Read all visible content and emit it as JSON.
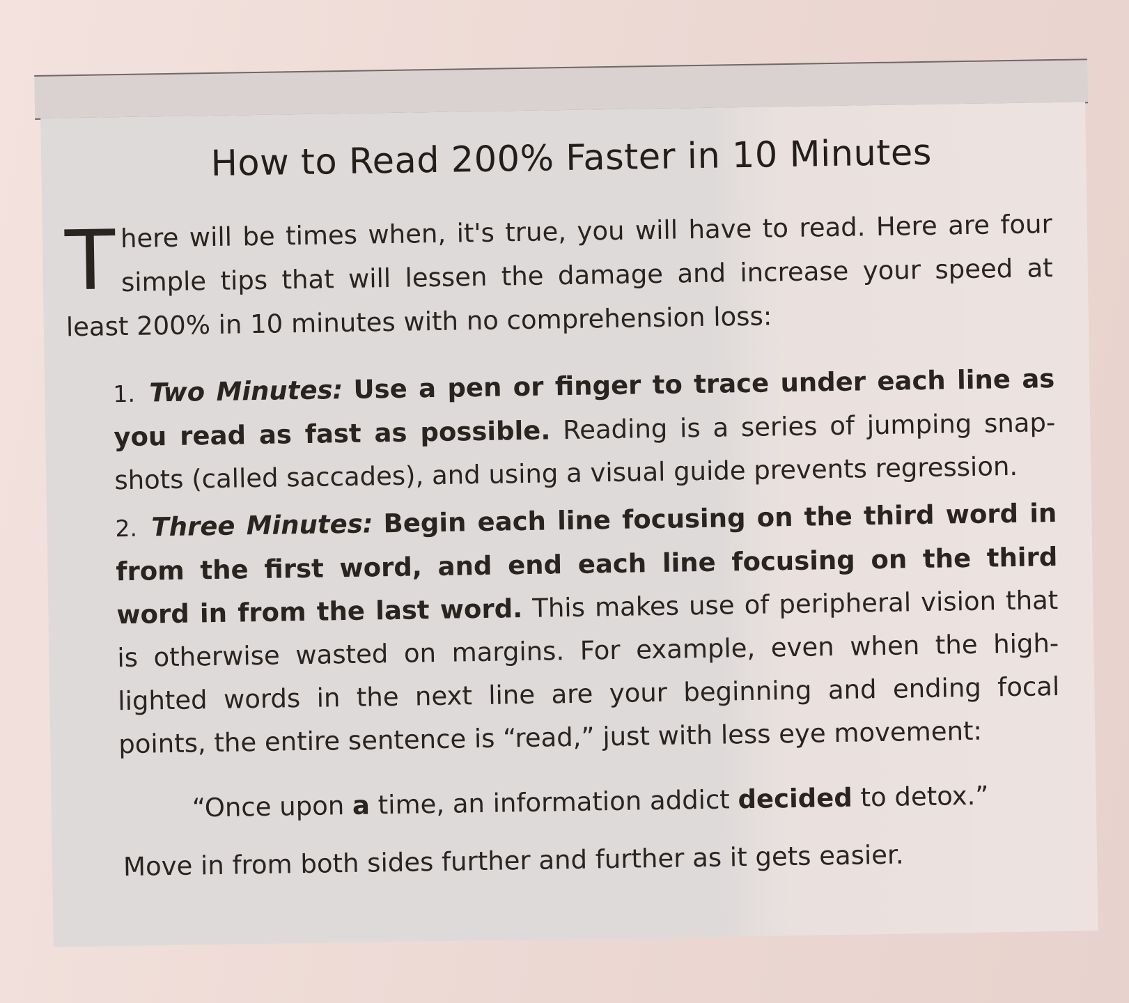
{
  "title": "How to Read 200% Faster in 10 Minutes",
  "intro": {
    "drop_cap": "T",
    "text": "here will be times when, it's true, you will have to read. Here are four simple tips that will lessen the damage and increase your speed at least 200% in 10 minutes with no comprehension loss:"
  },
  "tips": [
    {
      "number": "1.",
      "label": "Two Minutes:",
      "lead": "Use a pen or finger to trace under each line as you read as fast as possible.",
      "body": "Reading is a series of jumping snap-shots (called saccades), and using a visual guide prevents regression."
    },
    {
      "number": "2.",
      "label": "Three Minutes:",
      "lead": "Begin each line focusing on the third word in from the first word, and end each line focusing on the third word in from the last word.",
      "body": "This makes use of peripheral vision that is otherwise wasted on margins. For example, even when the high-lighted words in the next line are your beginning and ending focal points, the entire sentence is “read,” just with less eye movement:"
    }
  ],
  "example": {
    "part1": "“Once upon ",
    "emphasis1": "a",
    "part2": " time, an information addict ",
    "emphasis2": "decided",
    "part3": " to detox.”"
  },
  "closing": "Move in from both sides further and further as it gets easier."
}
